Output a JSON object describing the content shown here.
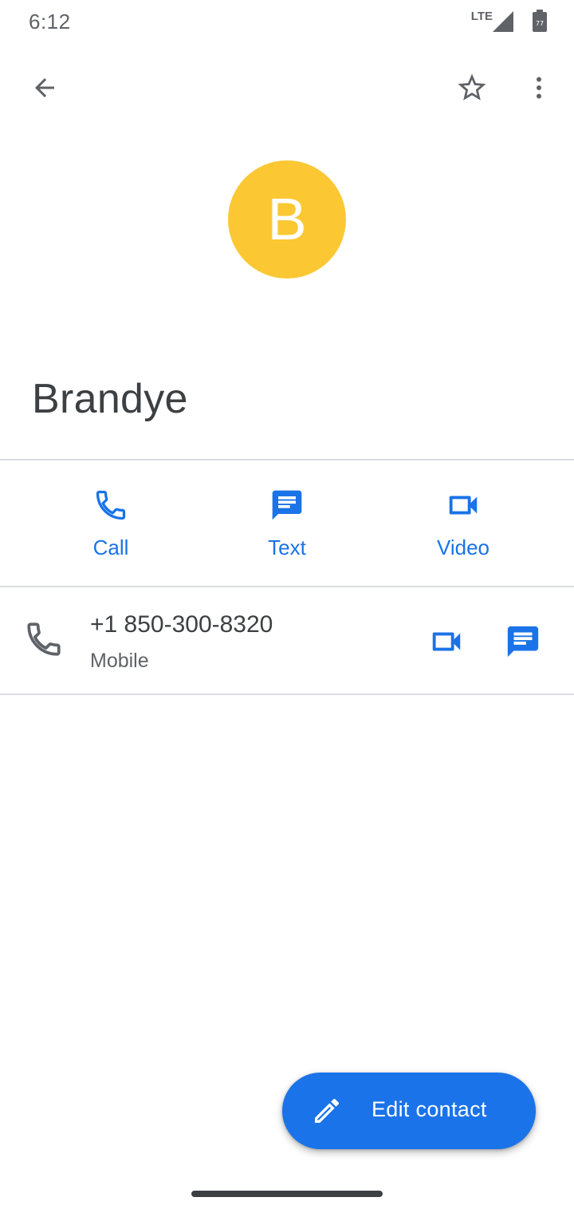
{
  "status_bar": {
    "time": "6:12",
    "network_label": "LTE",
    "battery_level": "77"
  },
  "app_bar": {
    "back_icon": "arrow-back-icon",
    "favorite_icon": "star-outline-icon",
    "more_icon": "more-vert-icon"
  },
  "contact": {
    "avatar_letter": "B",
    "avatar_color": "#fbc834",
    "name": "Brandye"
  },
  "actions": [
    {
      "label": "Call",
      "icon": "phone-icon"
    },
    {
      "label": "Text",
      "icon": "message-icon"
    },
    {
      "label": "Video",
      "icon": "videocam-icon"
    }
  ],
  "phone_entry": {
    "number": "+1 850-300-8320",
    "type": "Mobile"
  },
  "fab": {
    "label": "Edit contact",
    "icon": "edit-pencil-icon"
  },
  "colors": {
    "accent": "#1a73e8",
    "icon_gray": "#5f6368"
  }
}
